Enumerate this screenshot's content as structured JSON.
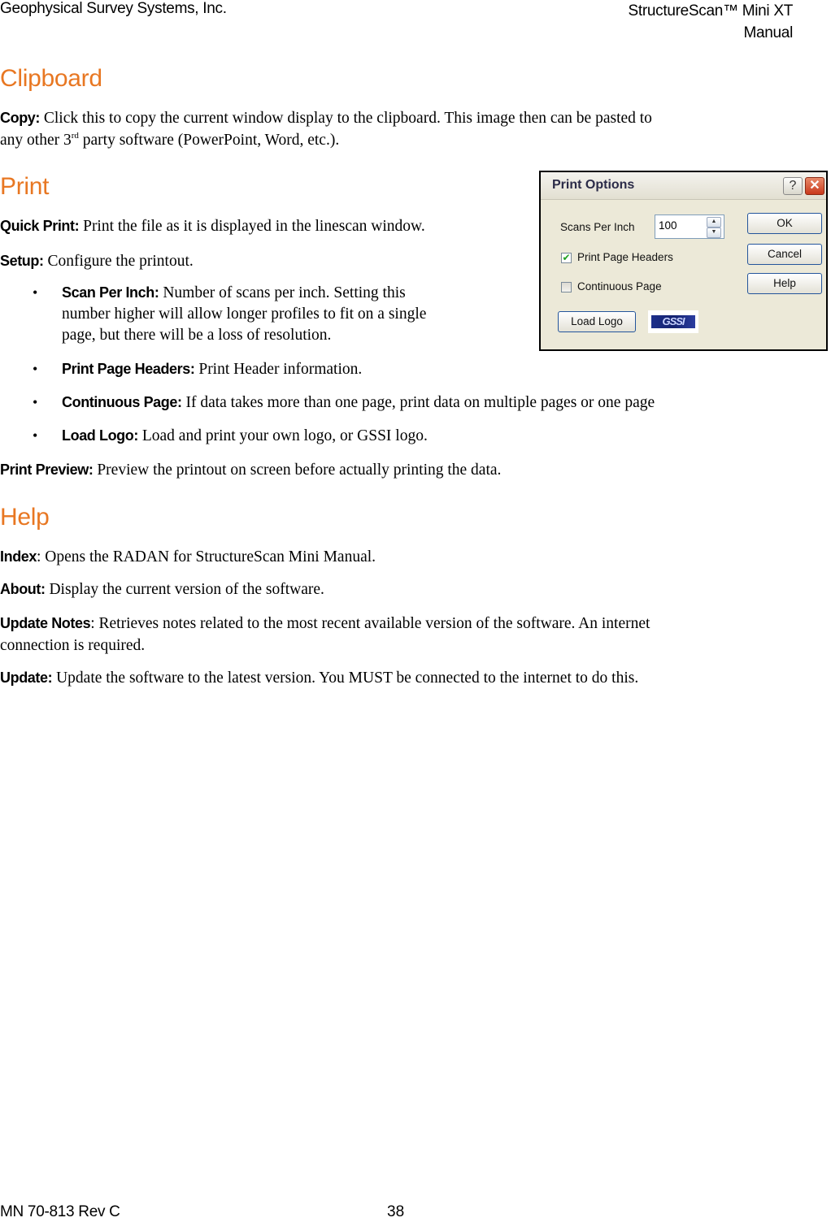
{
  "header": {
    "company": "Geophysical Survey Systems, Inc.",
    "product_line1": "StructureScan™ Mini XT",
    "product_line2": "Manual"
  },
  "sections": {
    "clipboard": {
      "title": "Clipboard",
      "copy_term": "Copy:",
      "copy_text_1": " Click this to copy the current window display to the clipboard. This image then can be pasted to",
      "copy_text_2a": "any other 3",
      "copy_sup": "rd",
      "copy_text_2b": " party software (PowerPoint, Word, etc.)."
    },
    "print": {
      "title": "Print",
      "quick_term": "Quick Print:",
      "quick_text": " Print the file as it is displayed in the linescan window.",
      "setup_term": "Setup:",
      "setup_text": " Configure the printout.",
      "bullets": [
        {
          "term": "Scan Per Inch:",
          "text_1": " Number of scans per inch. Setting this",
          "text_2": "number higher will allow longer profiles to fit on a single",
          "text_3": "page, but there will be a loss of resolution."
        },
        {
          "term": "Print Page Headers:",
          "text": " Print Header information."
        },
        {
          "term": "Continuous Page:",
          "text": " If data takes more than one page, print data on multiple pages or one page"
        },
        {
          "term": "Load Logo:",
          "text": " Load and print your own logo, or GSSI logo."
        }
      ],
      "preview_term": "Print Preview:",
      "preview_text": " Preview the printout on screen before actually printing the data."
    },
    "help": {
      "title": "Help",
      "index_term": "Index",
      "index_text": ": Opens the RADAN for StructureScan Mini Manual.",
      "about_term": "About:",
      "about_text": " Display the current version of the software.",
      "notes_term": "Update Notes",
      "notes_text_1": ": Retrieves notes related to the most recent available version of the software. An internet",
      "notes_text_2": "connection is required.",
      "update_term": "Update:",
      "update_text": " Update the software to the latest version. You MUST be connected to the internet to do this."
    }
  },
  "dialog": {
    "title": "Print Options",
    "help_glyph": "?",
    "close_glyph": "✕",
    "scans_label": "Scans Per Inch",
    "scans_value": "100",
    "spin_up": "▲",
    "spin_down": "▼",
    "headers_label": "Print Page Headers",
    "headers_checked": true,
    "check_glyph": "✔",
    "continuous_label": "Continuous Page",
    "continuous_checked": false,
    "ok_label": "OK",
    "cancel_label": "Cancel",
    "help_label": "Help",
    "load_logo_label": "Load Logo",
    "logo_text": "GSSI"
  },
  "footer": {
    "doc_number": "MN 70-813 Rev C",
    "page_number": "38"
  }
}
